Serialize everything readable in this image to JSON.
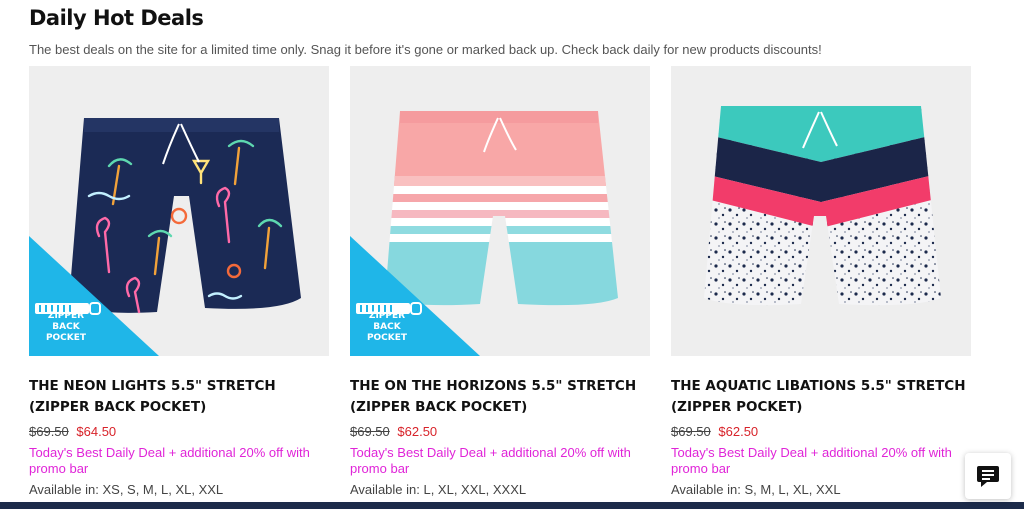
{
  "header": {
    "title": "Daily Hot Deals",
    "subtitle": "The best deals on the site for a limited time only. Snag it before it's gone or marked back up. Check back daily for new products discounts!"
  },
  "products": [
    {
      "name": "THE NEON LIGHTS 5.5\" STRETCH (ZIPPER BACK POCKET)",
      "old_price": "$69.50",
      "new_price": "$64.50",
      "promo": "Today's Best Daily Deal + additional 20% off with promo bar",
      "availability": "Available in: XS, S, M, L, XL, XXL",
      "badge": "ZIPPER BACK POCKET"
    },
    {
      "name": "THE ON THE HORIZONS 5.5\" STRETCH (ZIPPER BACK POCKET)",
      "old_price": "$69.50",
      "new_price": "$62.50",
      "promo": "Today's Best Daily Deal + additional 20% off with promo bar",
      "availability": "Available in: L, XL, XXL, XXXL",
      "badge": "ZIPPER BACK POCKET"
    },
    {
      "name": "THE AQUATIC LIBATIONS 5.5\" STRETCH (ZIPPER POCKET)",
      "old_price": "$69.50",
      "new_price": "$62.50",
      "promo": "Today's Best Daily Deal + additional 20% off with promo bar",
      "availability": "Available in: S, M, L, XL, XXL",
      "badge": ""
    }
  ],
  "icons": {
    "chat": "chat-icon"
  },
  "colors": {
    "sale_price": "#d8232a",
    "promo_text": "#e024d8",
    "badge": "#1fb6e8",
    "footer_bar": "#1c2b4a"
  }
}
